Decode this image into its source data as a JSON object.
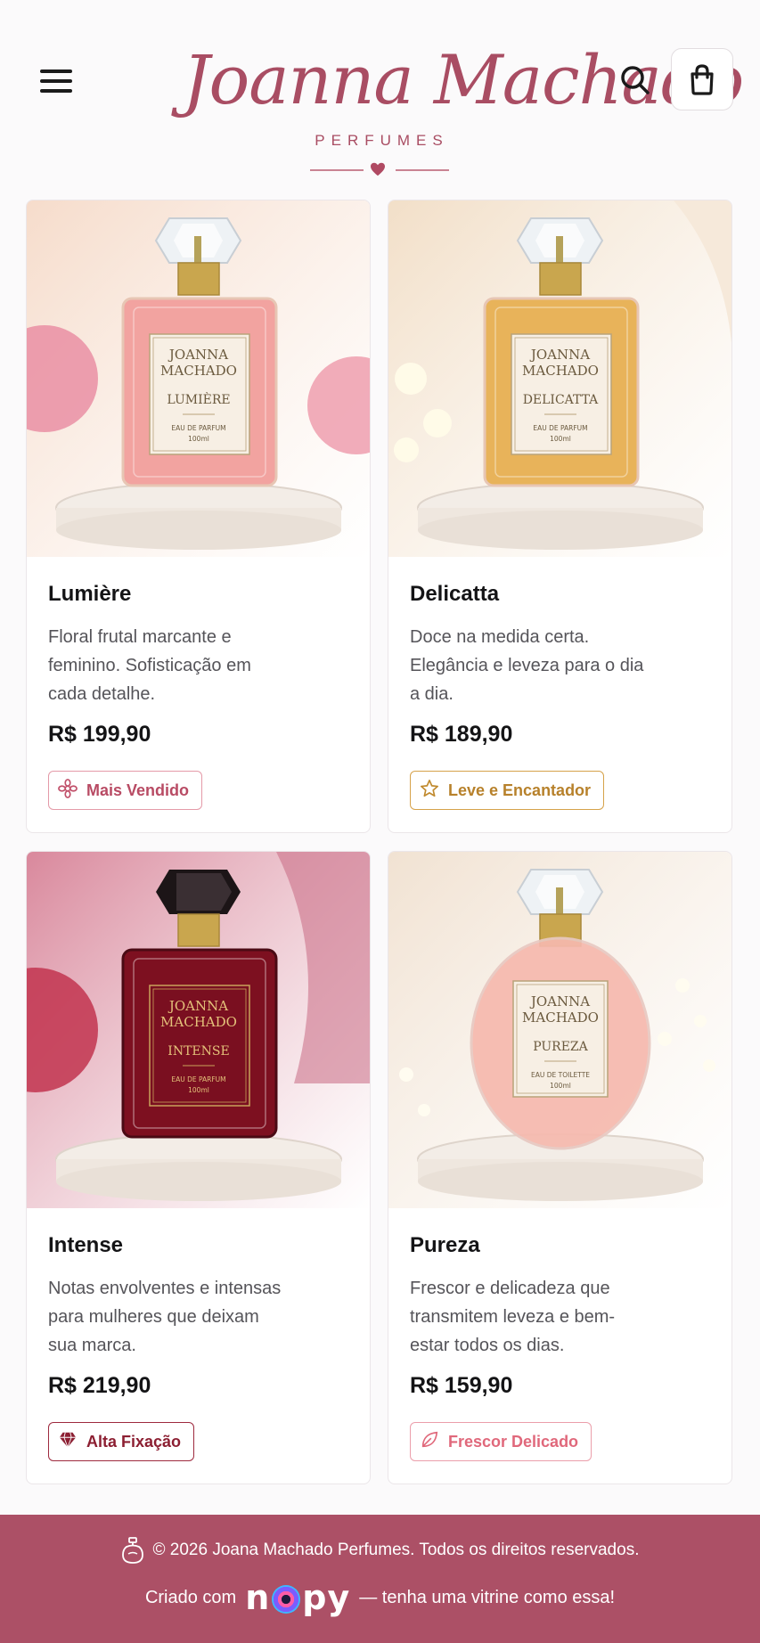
{
  "header": {
    "brand_script": "Joanna Machado",
    "brand_sub": "PERFUMES",
    "menu_icon": "hamburger-menu-icon",
    "search_icon": "search-icon",
    "cart_icon": "shopping-bag-icon"
  },
  "products": [
    {
      "name": "Lumière",
      "description": "Floral frutal marcante e feminino. Sofisticação em cada detalhe.",
      "price": "R$ 199,90",
      "badge": "Mais Vendido",
      "badge_icon": "flower-icon",
      "bottle_brand": "JOANNA MACHADO",
      "bottle_name": "LUMIÈRE",
      "bottle_type": "EAU DE PARFUM",
      "bottle_size": "100ml",
      "liquid_color": "#f2a3a0",
      "bg_color": "#f6dccb"
    },
    {
      "name": "Delicatta",
      "description": "Doce na medida certa. Elegância e leveza para o dia a dia.",
      "price": "R$ 189,90",
      "badge": "Leve e Encantador",
      "badge_icon": "star-icon",
      "bottle_brand": "JOANNA MACHADO",
      "bottle_name": "DELICATTA",
      "bottle_type": "EAU DE PARFUM",
      "bottle_size": "100ml",
      "liquid_color": "#e8b35a",
      "bg_color": "#f2dfc8"
    },
    {
      "name": "Intense",
      "description": "Notas envolventes e intensas para mulheres que deixam sua marca.",
      "price": "R$ 219,90",
      "badge": "Alta Fixação",
      "badge_icon": "diamond-icon",
      "bottle_brand": "JOANNA MACHADO",
      "bottle_name": "INTENSE",
      "bottle_type": "EAU DE PARFUM",
      "bottle_size": "100ml",
      "liquid_color": "#7d1020",
      "bg_color": "#d9889c"
    },
    {
      "name": "Pureza",
      "description": "Frescor e delicadeza que transmitem leveza e bem-estar todos os dias.",
      "price": "R$ 159,90",
      "badge": "Frescor Delicado",
      "badge_icon": "leaf-icon",
      "bottle_brand": "JOANNA MACHADO",
      "bottle_name": "PUREZA",
      "bottle_type": "EAU DE TOILETTE",
      "bottle_size": "100ml",
      "liquid_color": "#f6b9ae",
      "bg_color": "#f1e2d2"
    }
  ],
  "footer": {
    "copyright": "© 2026 Joana Machado Perfumes. Todos os direitos reservados.",
    "made_prefix": "Criado com",
    "made_brand_n": "n",
    "made_brand_py": "py",
    "made_suffix": "— tenha uma vitrine como essa!",
    "bg_color": "#ac5066"
  }
}
